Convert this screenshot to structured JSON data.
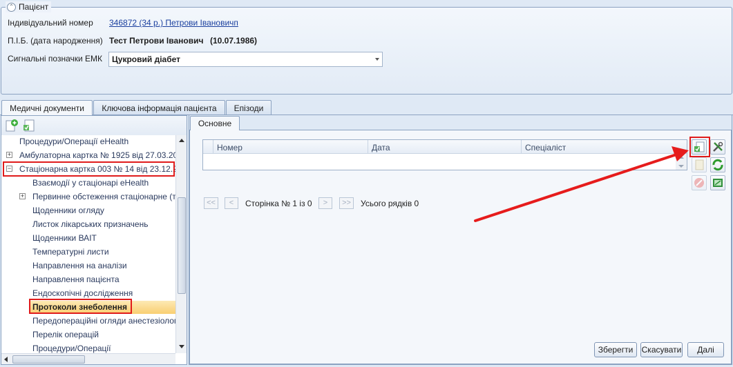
{
  "patient_panel": {
    "legend": "Пацієнт",
    "id_label": "Індивідуальний номер",
    "id_value": "346872 (34 р.) Петрови Івановичп",
    "name_label": "П.І.Б. (дата народження)",
    "name_value": "Тест Петрови Іванович",
    "birth_date": "(10.07.1986)",
    "signals_label": "Сигнальні позначки ЕМК",
    "signals_value": "Цукровий діабет"
  },
  "tabs": [
    {
      "label": "Медичні документи",
      "active": true
    },
    {
      "label": "Ключова інформація пацієнта",
      "active": false
    },
    {
      "label": "Епізоди",
      "active": false
    }
  ],
  "tree": {
    "items": [
      {
        "label": "Процедури/Операції eHealth"
      },
      {
        "label": "Амбулаторна картка № 1925 від 27.03.20"
      },
      {
        "label": "Стаціонарна картка 003 № 14 від 23.12.2"
      },
      {
        "label": "Взаємодії у стаціонарі eHealth"
      },
      {
        "label": "Первинне обстеження стаціонарне (т"
      },
      {
        "label": "Щоденники огляду"
      },
      {
        "label": "Листок лікарських призначень"
      },
      {
        "label": "Щоденники ВАІТ"
      },
      {
        "label": "Температурні листи"
      },
      {
        "label": "Направлення на аналізи"
      },
      {
        "label": "Направлення пацієнта"
      },
      {
        "label": "Ендоскопічні дослідження"
      },
      {
        "label": "Протоколи знеболення"
      },
      {
        "label": "Передопераційні огляди анестезіолог"
      },
      {
        "label": "Перелік операцій"
      },
      {
        "label": "Процедури/Операції"
      }
    ]
  },
  "inner_tab": "Основне",
  "grid": {
    "columns": [
      "Номер",
      "Дата",
      "Спеціаліст"
    ]
  },
  "pager": {
    "first": "<<",
    "prev": "<",
    "next": ">",
    "last": ">>",
    "page_text": "Сторінка № 1 із 0",
    "rows_text": "Усього рядків 0"
  },
  "footer": {
    "save": "Зберегти",
    "cancel": "Скасувати",
    "next": "Далі"
  },
  "colors": {
    "highlight_box": "#e01b1b",
    "selection": "#f9cf72",
    "link": "#1a3f9e"
  }
}
